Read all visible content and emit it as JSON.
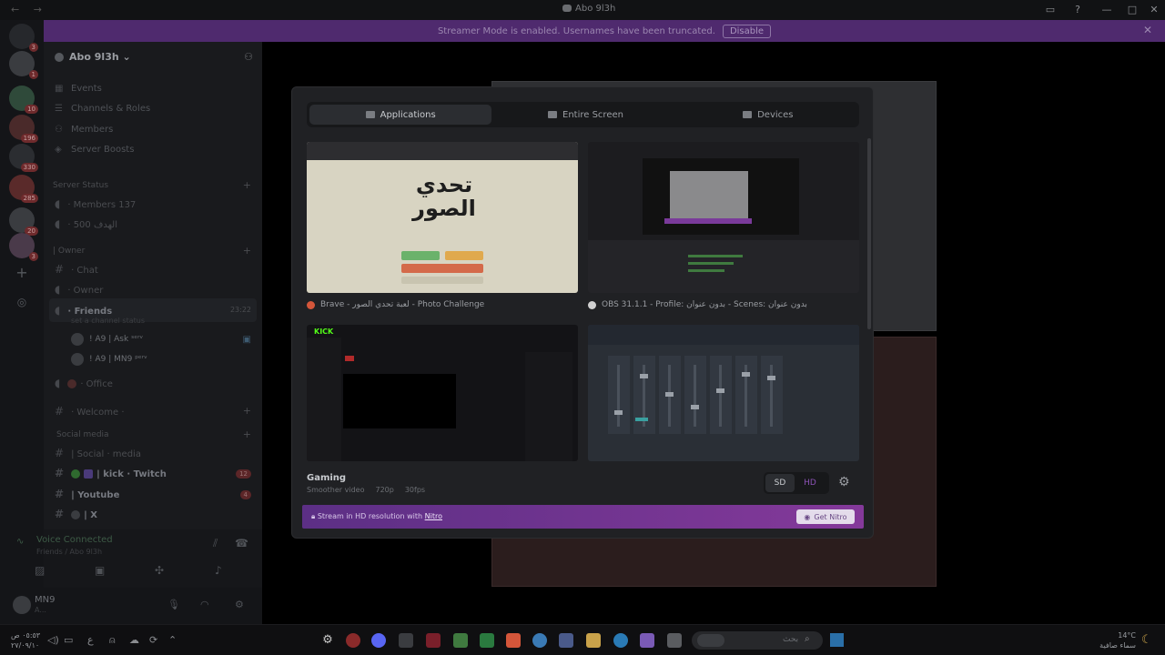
{
  "titlebar": {
    "title": "Abo 9l3h",
    "nav": "← →"
  },
  "banner": {
    "text": "Streamer Mode is enabled. Usernames have been truncated.",
    "disable_label": "Disable"
  },
  "rail": {
    "badges": [
      "3",
      "1",
      "10",
      "196",
      "330",
      "285",
      "20",
      "3"
    ]
  },
  "sidebar": {
    "guild_name": "Abo 9l3h",
    "menu": [
      {
        "label": "Events",
        "icon": "calendar-icon"
      },
      {
        "label": "Channels & Roles",
        "icon": "list-icon"
      },
      {
        "label": "Members",
        "icon": "members-icon"
      },
      {
        "label": "Server Boosts",
        "icon": "boost-icon"
      }
    ],
    "categories": {
      "server_status": "Server Status",
      "owner": "| Owner",
      "welcome": "Welcome",
      "social_media": "Social media"
    },
    "status_channels": [
      "· Members 137",
      "· الهدف 500"
    ],
    "channels": {
      "chat": "· Chat",
      "owner": "· Owner",
      "friends": "· Friends",
      "friends_time": "23:22",
      "friends_sub": "set a channel status",
      "office": "· Office",
      "welcome": "· Welcome ·",
      "social": "| Social · media",
      "kick": "| kick · Twitch",
      "kick_count": "12",
      "youtube": "| Youtube",
      "youtube_count": "4",
      "x": "| X"
    },
    "voice_members": [
      "! A9 | Ask ˢᵉʳᵛ",
      "! A9 | MN9 ᵖᵉʳᵛ"
    ],
    "voice": {
      "status": "Voice Connected",
      "location": "Friends / Abo 9l3h"
    },
    "user": {
      "name": "MN9",
      "status": "A..."
    }
  },
  "modal": {
    "tabs": [
      {
        "label": "Applications",
        "active": true
      },
      {
        "label": "Entire Screen",
        "active": false
      },
      {
        "label": "Devices",
        "active": false
      }
    ],
    "tiles": [
      {
        "label": "Brave - لعبة تحدي الصور - Photo Challenge",
        "thumb_text": "تحدي\nالصور",
        "icon_color": "#d4563a"
      },
      {
        "label": "OBS 31.1.1 - Profile: بدون عنوان - Scenes: بدون عنوان",
        "icon_color": "#d0d0d0"
      },
      {
        "label": "",
        "thumb_text": "KICK",
        "icon_color": "#53fc18"
      },
      {
        "label": "",
        "icon_color": "#3aa0a0"
      }
    ],
    "preset": {
      "title": "Gaming",
      "desc": "Smoother video",
      "resolution": "720p",
      "fps": "30fps"
    },
    "quality": {
      "sd": "SD",
      "hd": "HD"
    },
    "nitro": {
      "text": "Stream in HD resolution with",
      "link": "Nitro",
      "button": "Get Nitro"
    }
  },
  "taskbar": {
    "time": "٠٥:٥٣ ص",
    "date": "٢٧/٠٩/١٠",
    "search_placeholder": "بحث",
    "weather_temp": "14°C",
    "weather_desc": "سماء صافية",
    "lang": "ع"
  },
  "colors": {
    "accent": "#5865f2",
    "nitro": "#84399a",
    "banner": "#4f2a6e"
  }
}
